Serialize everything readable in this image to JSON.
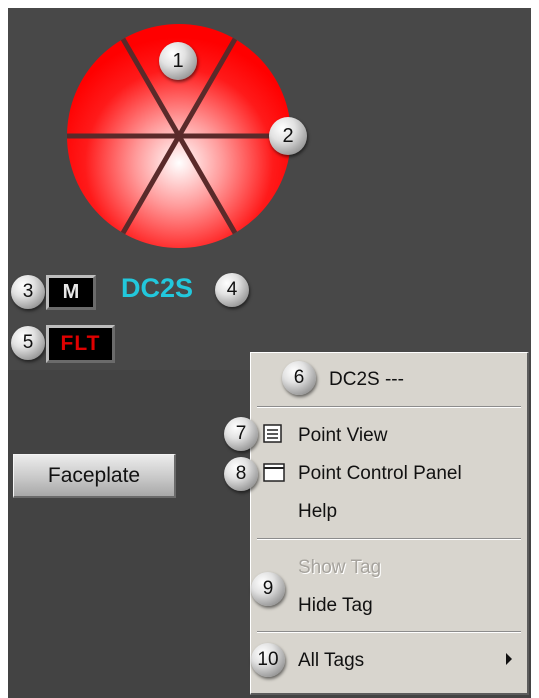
{
  "point": {
    "tag": "DC2S",
    "mode_indicator": "M",
    "fault_indicator": "FLT",
    "valve_color": "#ff1a1a"
  },
  "faceplate_button": {
    "label": "Faceplate"
  },
  "context_menu": {
    "header": "DC2S ---",
    "items": [
      {
        "label": "Point View",
        "icon": "point-view-icon",
        "enabled": true
      },
      {
        "label": "Point Control Panel",
        "icon": "control-panel-icon",
        "enabled": true
      },
      {
        "label": "Help",
        "enabled": true
      },
      {
        "label": "Show Tag",
        "enabled": false
      },
      {
        "label": "Hide Tag",
        "enabled": true
      },
      {
        "label": "All Tags",
        "icon": "submenu-arrow-icon",
        "enabled": true
      }
    ]
  },
  "callouts": [
    "1",
    "2",
    "3",
    "4",
    "5",
    "6",
    "7",
    "8",
    "9",
    "10"
  ],
  "colors": {
    "background": "#434343",
    "tag_text": "#22c8dc",
    "fault_text": "#e00000",
    "menu_background": "#d8d5ce"
  }
}
